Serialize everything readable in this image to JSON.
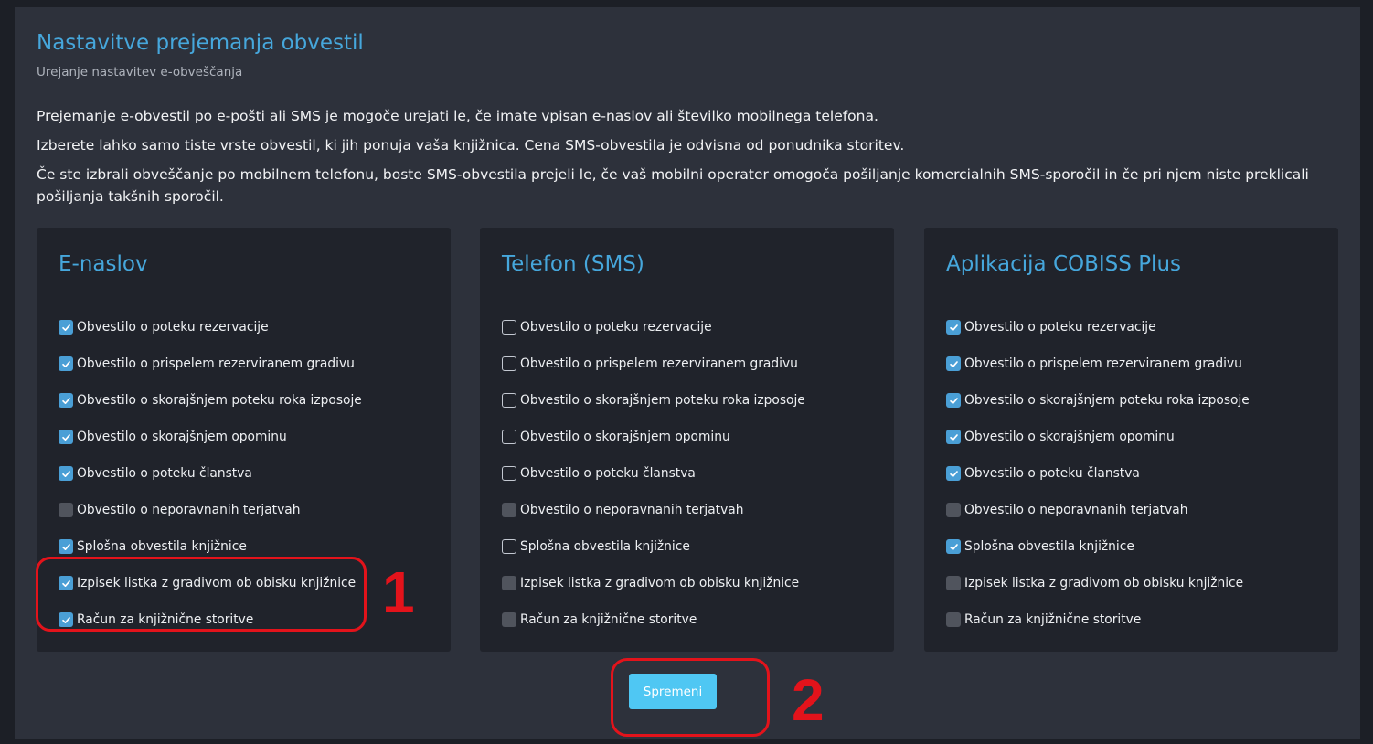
{
  "header": {
    "title": "Nastavitve prejemanja obvestil",
    "subtitle": "Urejanje nastavitev e-obveščanja"
  },
  "intro": [
    "Prejemanje e-obvestil po e-pošti ali SMS je mogoče urejati le, če imate vpisan e-naslov ali številko mobilnega telefona.",
    "Izberete lahko samo tiste vrste obvestil, ki jih ponuja vaša knjižnica. Cena SMS-obvestila je odvisna od ponudnika storitev.",
    "Če ste izbrali obveščanje po mobilnem telefonu, boste SMS-obvestila prejeli le, če vaš mobilni operater omogoča pošiljanje komercialnih SMS-sporočil in če pri njem niste preklicali pošiljanja takšnih sporočil."
  ],
  "option_labels": [
    "Obvestilo o poteku rezervacije",
    "Obvestilo o prispelem rezerviranem gradivu",
    "Obvestilo o skorajšnjem poteku roka izposoje",
    "Obvestilo o skorajšnjem opominu",
    "Obvestilo o poteku članstva",
    "Obvestilo o neporavnanih terjatvah",
    "Splošna obvestila knjižnice",
    "Izpisek listka z gradivom ob obisku knjižnice",
    "Račun za knjižnične storitve"
  ],
  "cards": [
    {
      "title": "E-naslov",
      "states": [
        "checked",
        "checked",
        "checked",
        "checked",
        "checked",
        "disabled",
        "checked",
        "checked",
        "checked"
      ]
    },
    {
      "title": "Telefon (SMS)",
      "states": [
        "unchecked",
        "unchecked",
        "unchecked",
        "unchecked",
        "unchecked",
        "disabled",
        "unchecked",
        "disabled",
        "disabled"
      ]
    },
    {
      "title": "Aplikacija COBISS Plus",
      "states": [
        "checked",
        "checked",
        "checked",
        "checked",
        "checked",
        "disabled",
        "checked",
        "disabled",
        "disabled"
      ]
    }
  ],
  "save_button": {
    "label": "Spremeni"
  },
  "annotations": {
    "marker_1": "1",
    "marker_2": "2"
  },
  "colors": {
    "accent": "#46a7dc",
    "checkbox_checked": "#4a9fd6",
    "button": "#4fc7f3",
    "annotation": "#e3131b"
  },
  "icons": {
    "checked": "checkmark-icon"
  }
}
